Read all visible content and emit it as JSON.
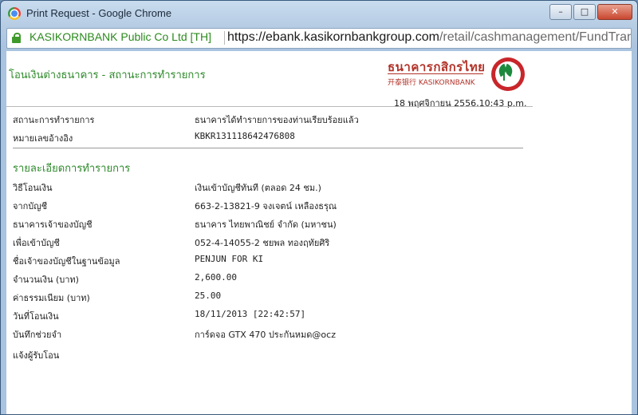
{
  "window": {
    "title": "Print Request - Google Chrome"
  },
  "address_bar": {
    "ev_label": "KASIKORNBANK Public Co Ltd [TH]",
    "url_scheme_host": "https://ebank.kasikornbankgroup.com",
    "url_path": "/retail/cashmanagement/FundTrans"
  },
  "page": {
    "title": "โอนเงินต่างธนาคาร - สถานะการทำรายการ",
    "logo_thai": "ธนาคารกสิกรไทย",
    "logo_en": "开泰银行 KASIKORNBANK",
    "date": "18 พฤศจิกายน 2556,10:43 p.m.",
    "status": {
      "label": "สถานะการทำรายการ",
      "value": "ธนาคารได้ทำรายการของท่านเรียบร้อยแล้ว"
    },
    "reference": {
      "label": "หมายเลขอ้างอิง",
      "value": "KBKR131118642476808"
    },
    "section_title": "รายละเอียดการทำรายการ",
    "details": [
      {
        "label": "วิธีโอนเงิน",
        "value": "เงินเข้าบัญชีทันที (ตลอด 24 ชม.)"
      },
      {
        "label": "จากบัญชี",
        "value": "663-2-13821-9 จงเจตน์ เหลืองธรุณ"
      },
      {
        "label": "ธนาคารเจ้าของบัญชี",
        "value": "ธนาคาร ไทยพาณิชย์ จำกัด (มหาชน)"
      },
      {
        "label": "เพื่อเข้าบัญชี",
        "value": "052-4-14055-2 ชยพล ทองฤทัยศิริ"
      },
      {
        "label": "ชื่อเจ้าของบัญชีในฐานข้อมูล",
        "value": "PENJUN FOR KI"
      },
      {
        "label": "จำนวนเงิน (บาท)",
        "value": "2,600.00"
      },
      {
        "label": "ค่าธรรมเนียม (บาท)",
        "value": "25.00"
      },
      {
        "label": "วันที่โอนเงิน",
        "value": "18/11/2013 [22:42:57]"
      },
      {
        "label": "บันทึกช่วยจำ",
        "value": "การ์ดจอ GTX 470 ประกันหมด@ocz"
      },
      {
        "label": "แจ้งผู้รับโอน",
        "value": ""
      }
    ]
  }
}
